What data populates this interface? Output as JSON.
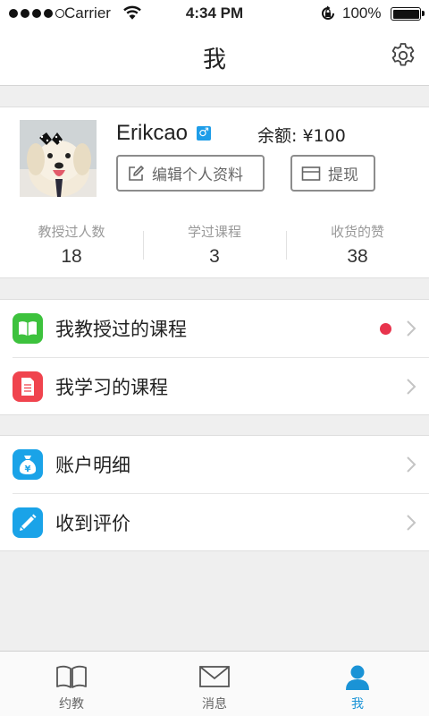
{
  "status_bar": {
    "carrier": "Carrier",
    "time": "4:34 PM",
    "battery": "100%",
    "battery_level": 1.0
  },
  "nav": {
    "title": "我",
    "settings_icon": "gear-icon"
  },
  "profile": {
    "avatar": "dog-photo-avatar",
    "username": "Erikcao",
    "gender_symbol": "♂",
    "balance": "余额: ¥100",
    "edit_label": "编辑个人资料",
    "withdraw_label": "提现",
    "stats": [
      {
        "label": "教授过人数",
        "value": "18"
      },
      {
        "label": "学过课程",
        "value": "3"
      },
      {
        "label": "收货的赞",
        "value": "38"
      }
    ]
  },
  "menu": {
    "group1": [
      {
        "label": "我教授过的课程",
        "icon": "book-icon",
        "color": "#3dc23d",
        "has_dot": true
      },
      {
        "label": "我学习的课程",
        "icon": "document-icon",
        "color": "#f0444e",
        "has_dot": false
      }
    ],
    "group2": [
      {
        "label": "账户明细",
        "icon": "money-bag-icon",
        "color": "#1aa3e8"
      },
      {
        "label": "收到评价",
        "icon": "pencil-icon",
        "color": "#1aa3e8"
      }
    ]
  },
  "colors": {
    "accent": "#1a93d6",
    "dot": "#e8344d",
    "background": "#efefef"
  },
  "tabs": [
    {
      "label": "约教",
      "icon": "book-icon",
      "active": false
    },
    {
      "label": "消息",
      "icon": "envelope-icon",
      "active": false
    },
    {
      "label": "我",
      "icon": "person-icon",
      "active": true
    }
  ]
}
